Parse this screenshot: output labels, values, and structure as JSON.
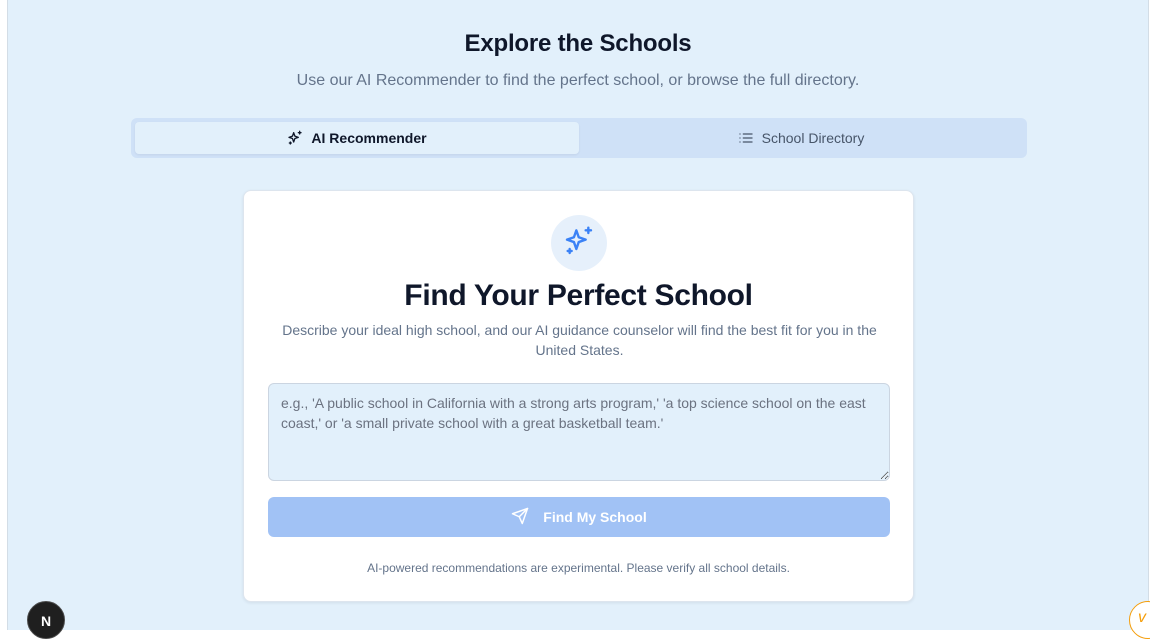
{
  "page": {
    "title": "Explore the Schools",
    "subtitle": "Use our AI Recommender to find the perfect school, or browse the full directory."
  },
  "tabs": [
    {
      "label": "AI Recommender",
      "icon": "sparkles-icon",
      "active": true
    },
    {
      "label": "School Directory",
      "icon": "list-icon",
      "active": false
    }
  ],
  "card": {
    "icon": "sparkles-icon",
    "title": "Find Your Perfect School",
    "description": "Describe your ideal high school, and our AI guidance counselor will find the best fit for you in the United States.",
    "input": {
      "value": "",
      "placeholder": "e.g., 'A public school in California with a strong arts program,' 'a top science school on the east coast,' or 'a small private school with a great basketball team.'"
    },
    "button": {
      "label": "Find My School",
      "icon": "send-icon",
      "disabled": true
    },
    "disclaimer": "AI-powered recommendations are experimental. Please verify all school details."
  },
  "overlays": {
    "next_badge_letter": "N",
    "corner_badge_letter": "v"
  },
  "colors": {
    "background": "#e2f0fb",
    "accent": "#3b82f6",
    "button_disabled": "#a1c2f5",
    "tab_track": "#cfe1f7",
    "text_primary": "#0f172a",
    "text_muted": "#64748b"
  }
}
